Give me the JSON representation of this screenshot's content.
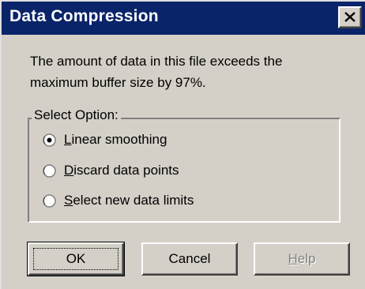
{
  "window": {
    "title": "Data Compression"
  },
  "message": {
    "line1": "The amount of data in this file exceeds the",
    "line2": "maximum buffer size by 97%."
  },
  "options": {
    "legend": "Select Option:",
    "items": [
      {
        "label": "Linear smoothing",
        "selected": true
      },
      {
        "label": "Discard data points",
        "selected": false
      },
      {
        "label": "Select new data limits",
        "selected": false
      }
    ]
  },
  "buttons": {
    "ok": "OK",
    "cancel": "Cancel",
    "help": "Help",
    "help_enabled": false
  },
  "colors": {
    "titlebar": "#0a246a",
    "face": "#d4d0c8"
  }
}
